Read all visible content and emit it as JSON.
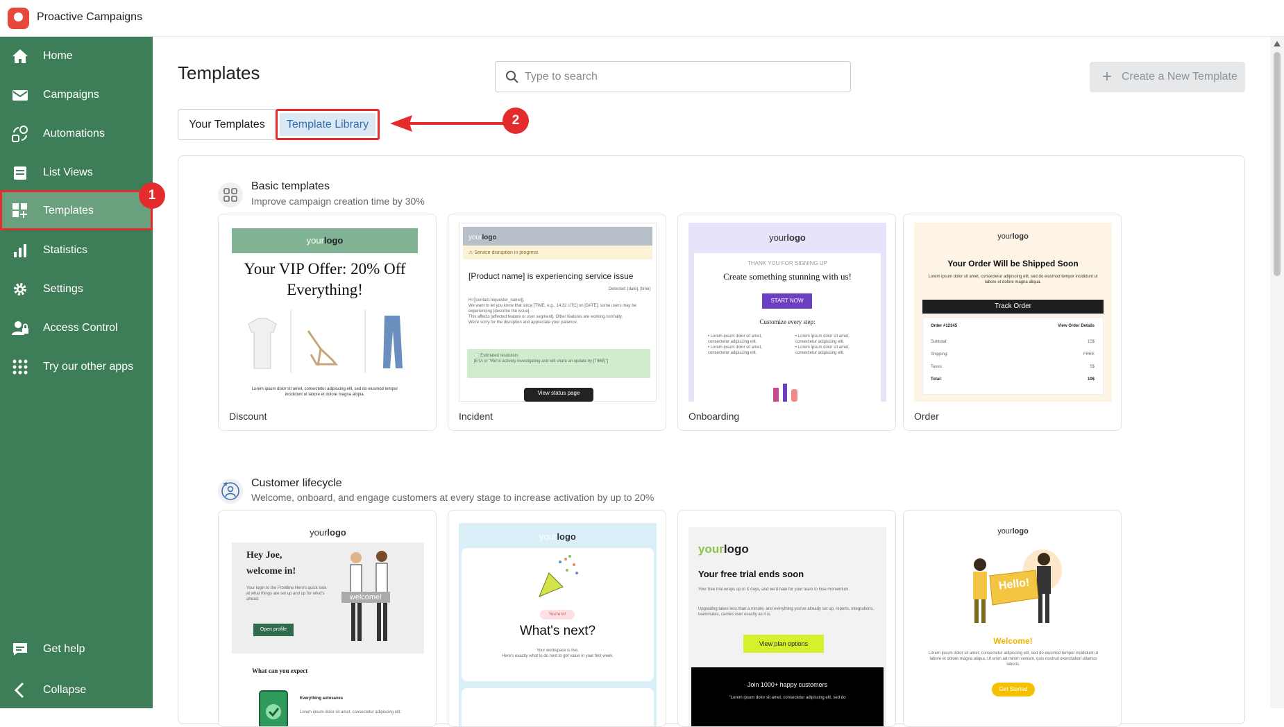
{
  "app": {
    "title": "Proactive Campaigns"
  },
  "sidebar": {
    "items": [
      {
        "label": "Home",
        "icon": "home-icon"
      },
      {
        "label": "Campaigns",
        "icon": "envelope-icon"
      },
      {
        "label": "Automations",
        "icon": "automation-icon"
      },
      {
        "label": "List Views",
        "icon": "list-icon"
      },
      {
        "label": "Templates",
        "icon": "templates-icon",
        "active": true
      },
      {
        "label": "Statistics",
        "icon": "bar-chart-icon"
      },
      {
        "label": "Settings",
        "icon": "gear-icon"
      },
      {
        "label": "Access Control",
        "icon": "user-lock-icon"
      },
      {
        "label": "Try our other apps",
        "icon": "apps-grid-icon"
      }
    ],
    "bottom": [
      {
        "label": "Get help",
        "icon": "help-chat-icon"
      },
      {
        "label": "Collapse",
        "icon": "chevron-left-icon"
      }
    ],
    "color": "#3d7d58"
  },
  "header": {
    "title": "Templates",
    "search_placeholder": "Type to search",
    "create_label": "Create a New Template"
  },
  "tabs": [
    {
      "label": "Your Templates",
      "selected": false
    },
    {
      "label": "Template Library",
      "selected": true
    }
  ],
  "annotations": {
    "badge1": "1",
    "badge2": "2",
    "color": "#e52c2c"
  },
  "sections": [
    {
      "title": "Basic templates",
      "subtitle": "Improve campaign creation time by 30%",
      "cards": [
        {
          "label": "Discount",
          "logo": [
            "your",
            "logo"
          ],
          "heading": "Your VIP Offer: 20% Off Everything!",
          "body": "Lorem ipsum dolor sit amet, consectetur adipiscing elit, sed do eiusmod tempor incididunt ut labore et dolore magna aliqua."
        },
        {
          "label": "Incident",
          "logo": [
            "your",
            "logo"
          ],
          "alert": "⚠ Service disruption in progress",
          "heading": "[Product name] is experiencing service issue",
          "detected": "Detected: [date], [time]",
          "body": "Hi [[contact.requester_name]],\nWe want to let you know that since [TIME, e.g., 14:32 UTC] on [DATE], some users may be experiencing [describe the issue].\nThis affects [affected feature or user segment]. Other features are working normally.\nWe're sorry for the disruption and appreciate your patience.",
          "resolution_title": "🕓 Estimated resolution",
          "resolution_text": "[ETA or \"We're actively investigating and will share an update by [TIME]\"]",
          "button": "View status page"
        },
        {
          "label": "Onboarding",
          "logo": [
            "your",
            "logo"
          ],
          "kicker": "THANK YOU FOR SIGNING UP",
          "heading": "Create something stunning with us!",
          "button": "START NOW",
          "sub": "Customize every step:",
          "bullets": [
            "Lorem ipsum dolor sit amet, consectetur adipiscing elit.",
            "Lorem ipsum dolor sit amet, consectetur adipiscing elit.",
            "Lorem ipsum dolor sit amet, consectetur adipiscing elit.",
            "Lorem ipsum dolor sit amet, consectetur adipiscing elit."
          ]
        },
        {
          "label": "Order",
          "logo": [
            "your",
            "logo"
          ],
          "heading": "Your Order Will be Shipped Soon",
          "body": "Lorem ipsum dolor sit amet, consectetur adipiscing elit, sed do eiusmod tempor incididunt ut labore et dolore magna aliqua.",
          "button": "Track Order",
          "order_no": "Order #12345",
          "order_link": "View Order Details",
          "rows": [
            [
              "Subtotal:",
              "10$"
            ],
            [
              "Shipping:",
              "FREE"
            ],
            [
              "Taxes:",
              "5$"
            ],
            [
              "Total:",
              "10$"
            ]
          ]
        }
      ]
    },
    {
      "title": "Customer lifecycle",
      "subtitle": "Welcome, onboard, and engage customers at every stage to increase activation by up to 20%",
      "cards": [
        {
          "logo": [
            "your",
            "logo"
          ],
          "heading1": "Hey Joe,",
          "heading2": "welcome in!",
          "body": "Your login to the Frontline Hero's quick look at what things are set up and up for what's ahead.",
          "sign": "welcome!",
          "button": "Open profile",
          "sub": "What can you expect",
          "feature_title": "Everything autosaves",
          "feature_text": "Lorem ipsum dolor sit amet, consectetur adipiscing elit."
        },
        {
          "logo": [
            "your",
            "logo"
          ],
          "pill": "You're in!",
          "heading": "What's next?",
          "body": "Your workspace is live.\nHere's exactly what to do next to get value in your first week."
        },
        {
          "logo": [
            "your",
            "logo"
          ],
          "heading": "Your free trial ends soon",
          "body1": "Your free trial wraps up in X days, and we'd hate for your team to lose momentum.",
          "body2": "Upgrading takes less than a minute, and everything you've already set up, reports, integrations, teammates, carries over exactly as it is.",
          "button": "View plan options",
          "footer": "Join 1000+ happy customers",
          "footer_sub": "\"Lorem ipsum dolor sit amet, consectetur adipiscing elit, sed do"
        },
        {
          "logo": [
            "your",
            "logo"
          ],
          "sign": "Hello!",
          "heading": "Welcome!",
          "body": "Lorem ipsum dolor sit amet, consectetur adipiscing elit, sed do eiusmod tempor incididunt ut labore et dolore magna aliqua. Ut enim ad minim veniam, quis nostrud exercitation ullamco laboris.",
          "button": "Get Started"
        }
      ]
    }
  ]
}
